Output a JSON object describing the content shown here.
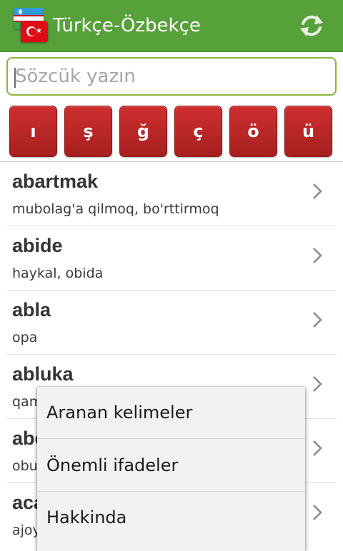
{
  "app": {
    "title": "Türkçe-Özbekçe",
    "left_flag_icon": "uzbekistan-flag-icon",
    "right_flag_icon": "turkey-flag-icon",
    "action_icon": "refresh-icon",
    "bar_color": "#57a13a"
  },
  "search": {
    "placeholder": "Sözcük yazın",
    "value": ""
  },
  "letter_buttons": {
    "color": "#b82626",
    "labels": [
      "ı",
      "ş",
      "ğ",
      "ç",
      "ö",
      "ü"
    ]
  },
  "entries": [
    {
      "word": "abartmak",
      "meaning": "mubolag'a qilmoq, bo'rttirmoq"
    },
    {
      "word": "abide",
      "meaning": "haykal, obida"
    },
    {
      "word": "abla",
      "meaning": "opa"
    },
    {
      "word": "abluka",
      "meaning": "qam"
    },
    {
      "word": "abe",
      "meaning": "obu"
    },
    {
      "word": "aca",
      "meaning": "ajoy"
    }
  ],
  "menu": {
    "items": [
      "Aranan kelimeler",
      "Önemli ifadeler",
      "Hakkinda"
    ]
  }
}
